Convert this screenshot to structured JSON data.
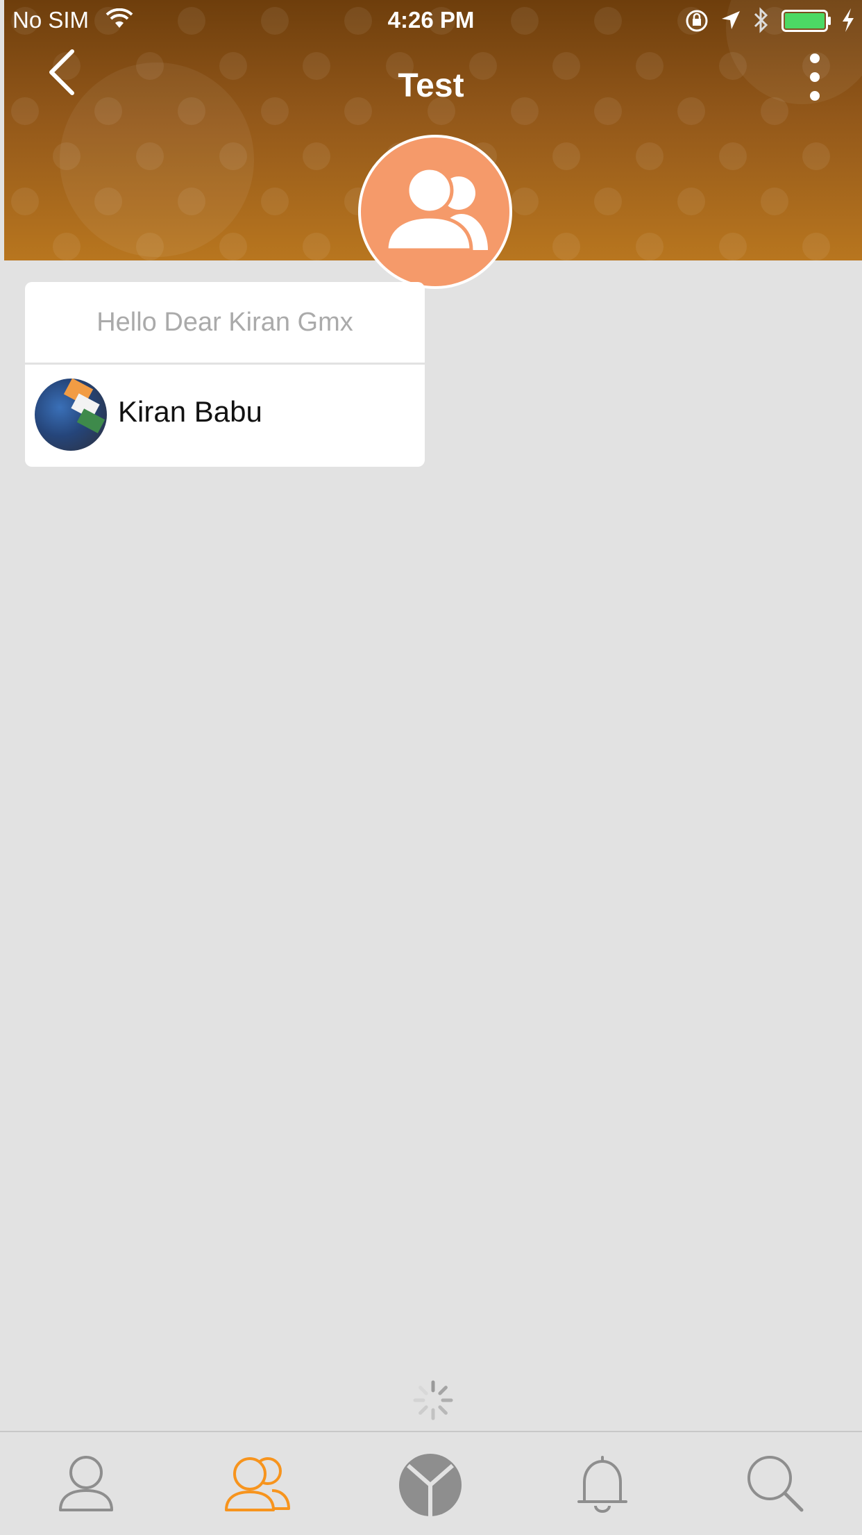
{
  "status_bar": {
    "carrier": "No SIM",
    "time": "4:26 PM",
    "icons": [
      "wifi-icon",
      "orientation-lock-icon",
      "location-icon",
      "bluetooth-icon",
      "battery-icon",
      "charging-icon"
    ],
    "battery_color": "#4cd964"
  },
  "header": {
    "title": "Test",
    "back_icon": "chevron-left-icon",
    "more_icon": "more-vertical-icon",
    "gradient": [
      "#6e3e0c",
      "#b8761f"
    ],
    "group_avatar_icon": "group-icon",
    "group_avatar_color": "#f59a6a"
  },
  "card": {
    "message": "Hello Dear Kiran Gmx",
    "members": [
      {
        "name": "Kiran Babu"
      }
    ]
  },
  "tab_bar": {
    "tabs": [
      {
        "icon": "profile-icon",
        "active": false
      },
      {
        "icon": "groups-icon",
        "active": true
      },
      {
        "icon": "home-logo-icon",
        "active": false
      },
      {
        "icon": "notifications-bell-icon",
        "active": false
      },
      {
        "icon": "search-icon",
        "active": false
      }
    ],
    "active_color": "#f7941d",
    "inactive_color": "#8e8e8e"
  }
}
